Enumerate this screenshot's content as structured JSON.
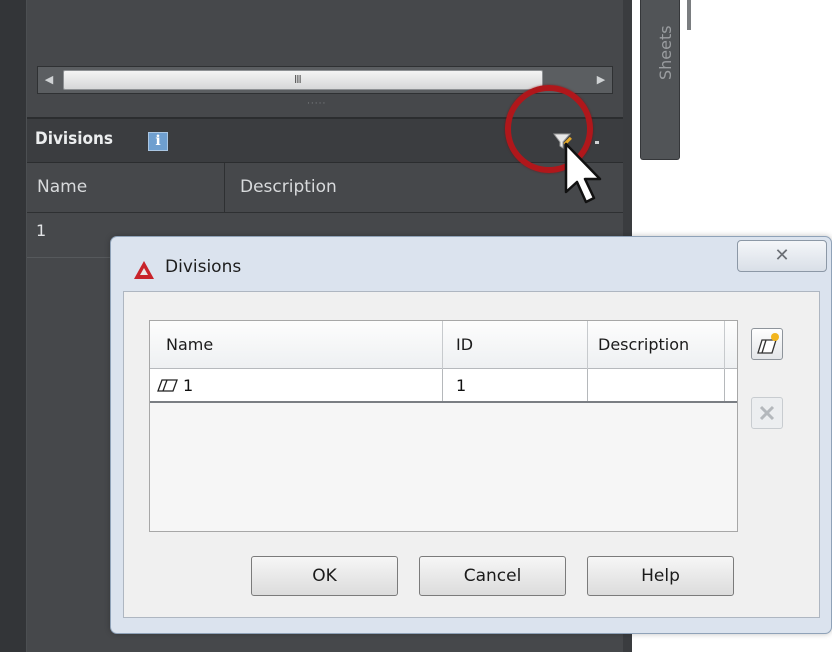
{
  "palette": {
    "panel_bg": "#46484b",
    "header_bg": "#3b3d40",
    "highlight_red": "#b0171b",
    "dialog_bg": "#dbe3ee",
    "info_blue": "#6f9fcf"
  },
  "panel": {
    "scrollbar_grip": "III",
    "scroll_left_arrow": "◀",
    "scroll_right_arrow": "▶",
    "splitter_dots": "·····",
    "divisions_title": "Divisions",
    "info_icon": "i",
    "columns": {
      "name": "Name",
      "description": "Description"
    },
    "rows": [
      {
        "name": "1",
        "description": ""
      }
    ],
    "side_tab": "Sheets",
    "icons": {
      "filter": "filter-edit-icon",
      "info": "info-icon",
      "cursor": "mouse-pointer-icon"
    }
  },
  "dialog": {
    "title": "Divisions",
    "close": "✕",
    "app_icon": "autocad-icon",
    "columns": {
      "name": "Name",
      "id": "ID",
      "description": "Description"
    },
    "rows": [
      {
        "name": "1",
        "id": "1",
        "description": ""
      }
    ],
    "buttons": {
      "ok": "OK",
      "cancel": "Cancel",
      "help": "Help"
    },
    "side_icons": {
      "add": "add-division-icon",
      "delete": "delete-division-icon"
    },
    "row_icon": "division-icon"
  }
}
